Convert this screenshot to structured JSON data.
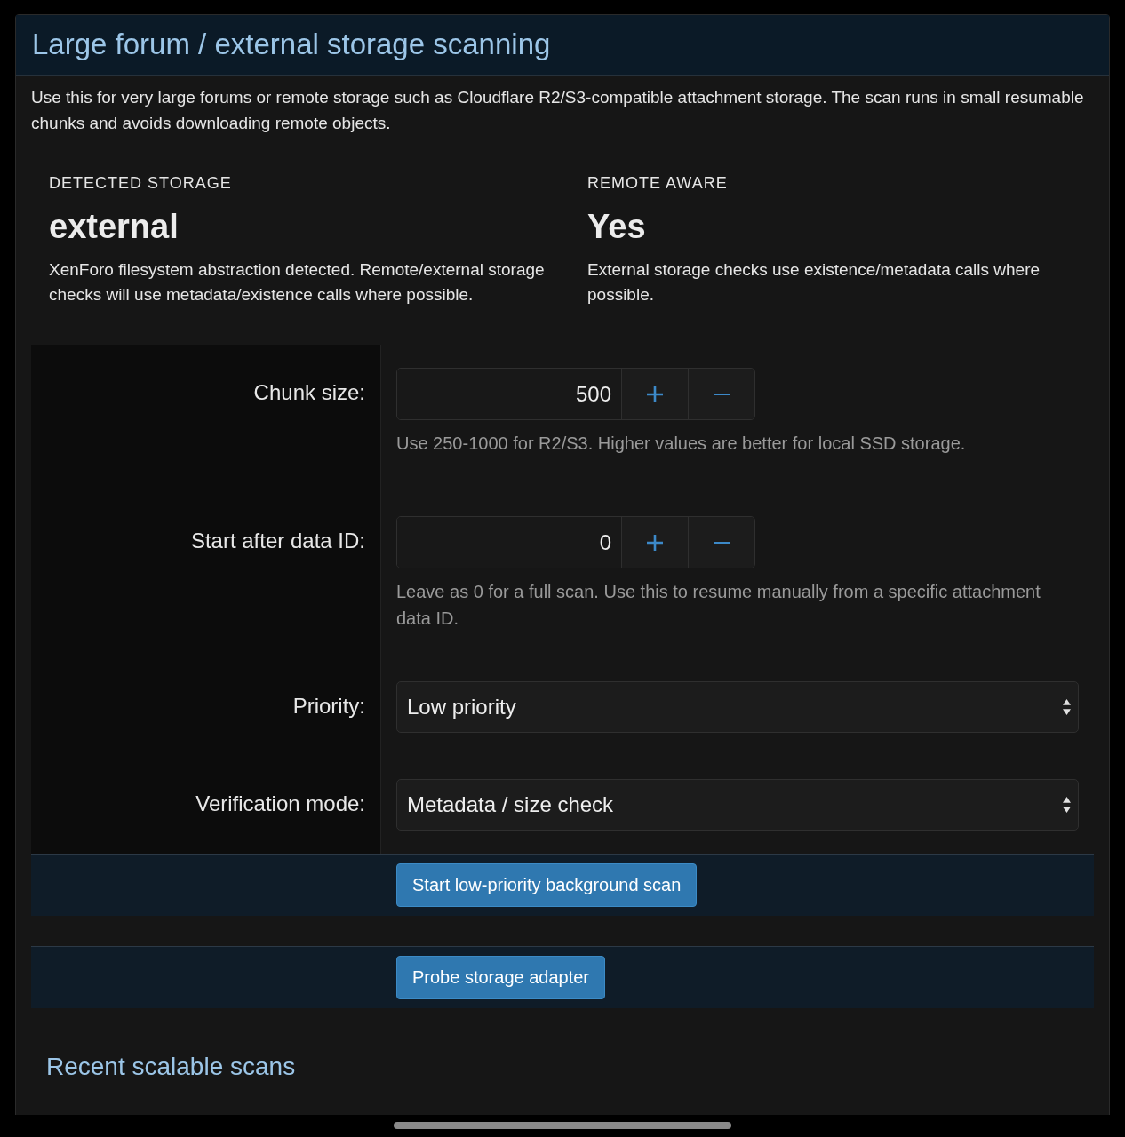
{
  "panel": {
    "title": "Large forum / external storage scanning",
    "intro": "Use this for very large forums or remote storage such as Cloudflare R2/S3-compatible attachment storage. The scan runs in small resumable chunks and avoids downloading remote objects."
  },
  "storage_info": [
    {
      "label": "DETECTED STORAGE",
      "value": "external",
      "description": "XenForo filesystem abstraction detected. Remote/external storage checks will use metadata/existence calls where possible."
    },
    {
      "label": "REMOTE AWARE",
      "value": "Yes",
      "description": "External storage checks use existence/metadata calls where possible."
    }
  ],
  "form_rows": [
    {
      "kind": "number",
      "label": "Chunk size:",
      "value": "500",
      "hint": "Use 250-1000 for R2/S3. Higher values are better for local SSD storage."
    },
    {
      "kind": "number",
      "label": "Start after data ID:",
      "value": "0",
      "hint": "Leave as 0 for a full scan. Use this to resume manually from a specific attachment data ID."
    },
    {
      "kind": "select",
      "label": "Priority:",
      "value": "Low priority"
    },
    {
      "kind": "select",
      "label": "Verification mode:",
      "value": "Metadata / size check"
    }
  ],
  "actions": [
    {
      "label": "Start low-priority background scan"
    },
    {
      "label": "Probe storage adapter"
    }
  ],
  "recent": {
    "title": "Recent scalable scans"
  }
}
